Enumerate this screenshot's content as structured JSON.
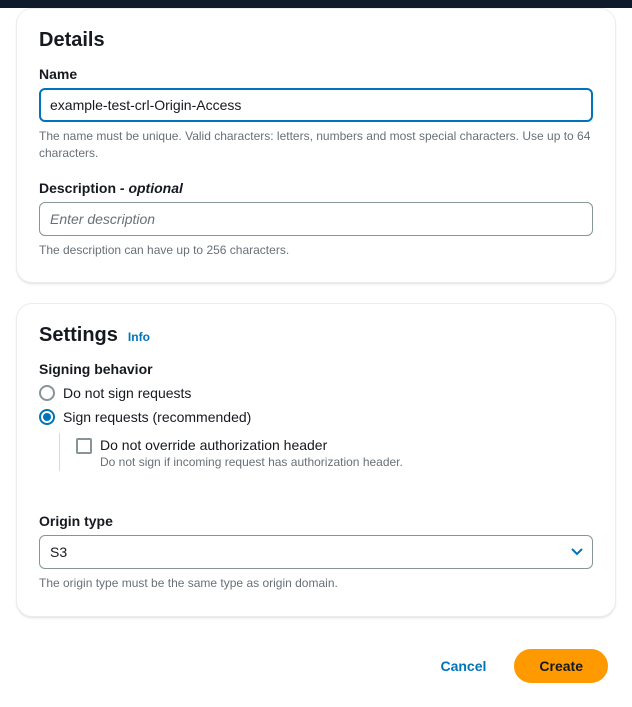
{
  "details": {
    "title": "Details",
    "name": {
      "label": "Name",
      "value": "example-test-crl-Origin-Access",
      "help": "The name must be unique. Valid characters: letters, numbers and most special characters. Use up to 64 characters."
    },
    "description": {
      "label_main": "Description",
      "label_optional": " - optional",
      "placeholder": "Enter description",
      "help": "The description can have up to 256 characters."
    }
  },
  "settings": {
    "title": "Settings",
    "info_label": "Info",
    "signing": {
      "label": "Signing behavior",
      "options": {
        "none": "Do not sign requests",
        "sign": "Sign requests (recommended)"
      },
      "selected": "sign",
      "override": {
        "label": "Do not override authorization header",
        "help": "Do not sign if incoming request has authorization header."
      }
    },
    "origin_type": {
      "label": "Origin type",
      "value": "S3",
      "help": "The origin type must be the same type as origin domain."
    }
  },
  "actions": {
    "cancel": "Cancel",
    "create": "Create"
  }
}
